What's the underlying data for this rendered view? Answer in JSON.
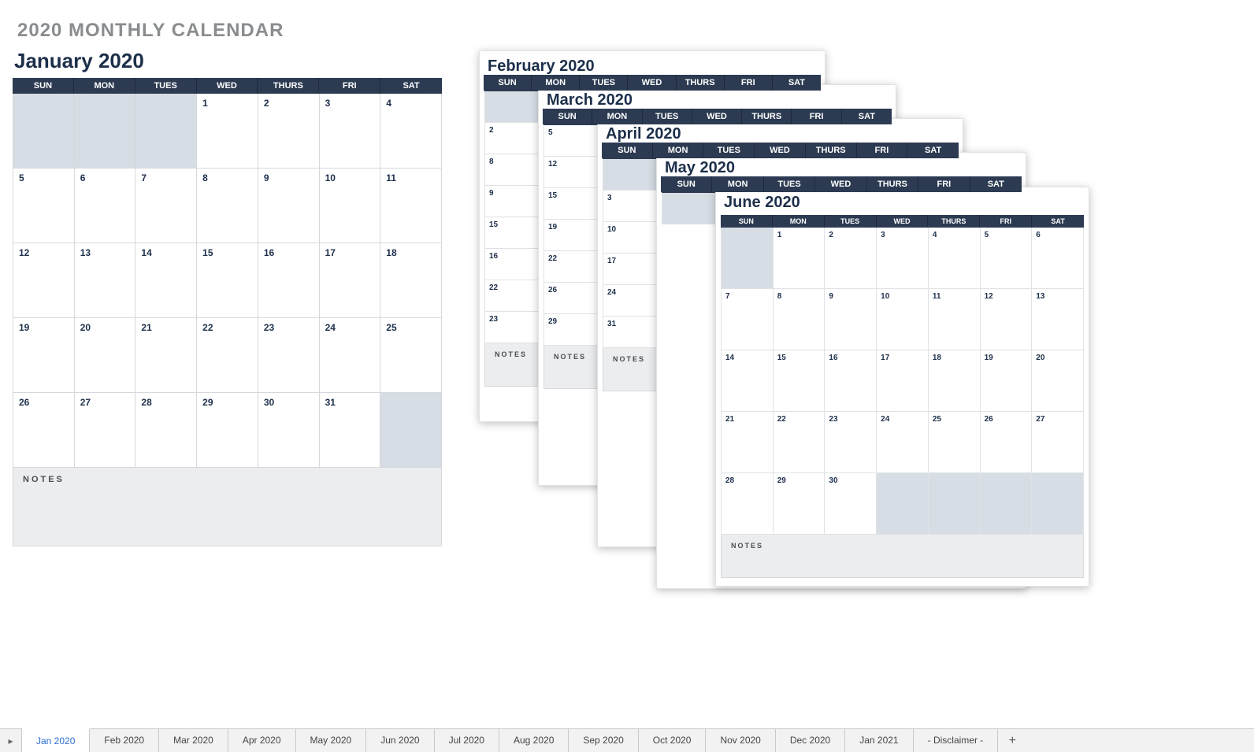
{
  "title": "2020 MONTHLY CALENDAR",
  "day_labels": [
    "SUN",
    "MON",
    "TUES",
    "WED",
    "THURS",
    "FRI",
    "SAT"
  ],
  "notes_label": "NOTES",
  "main_month": {
    "title": "January 2020",
    "pad_before": 3,
    "days": 31,
    "pad_after": 1
  },
  "stack": [
    {
      "id": "feb",
      "title": "February 2020",
      "first_col_days": [
        "2",
        "8",
        "9",
        "15",
        "16",
        "22",
        "23"
      ]
    },
    {
      "id": "mar",
      "title": "March 2020",
      "first_col_days": [
        "5",
        "12",
        "15",
        "19",
        "22",
        "26",
        "29"
      ]
    },
    {
      "id": "apr",
      "title": "April 2020",
      "first_col_days": [
        "3",
        "10",
        "17",
        "24",
        "31"
      ]
    },
    {
      "id": "may",
      "title": "May 2020",
      "first_col_days": []
    }
  ],
  "top_month": {
    "title": "June 2020",
    "pad_before": 1,
    "days": 30,
    "pad_after": 4
  },
  "tabs": [
    "Jan 2020",
    "Feb 2020",
    "Mar 2020",
    "Apr 2020",
    "May 2020",
    "Jun 2020",
    "Jul 2020",
    "Aug 2020",
    "Sep 2020",
    "Oct 2020",
    "Nov 2020",
    "Dec 2020",
    "Jan 2021",
    "- Disclaimer -"
  ],
  "active_tab": 0,
  "add_tab_label": "+"
}
